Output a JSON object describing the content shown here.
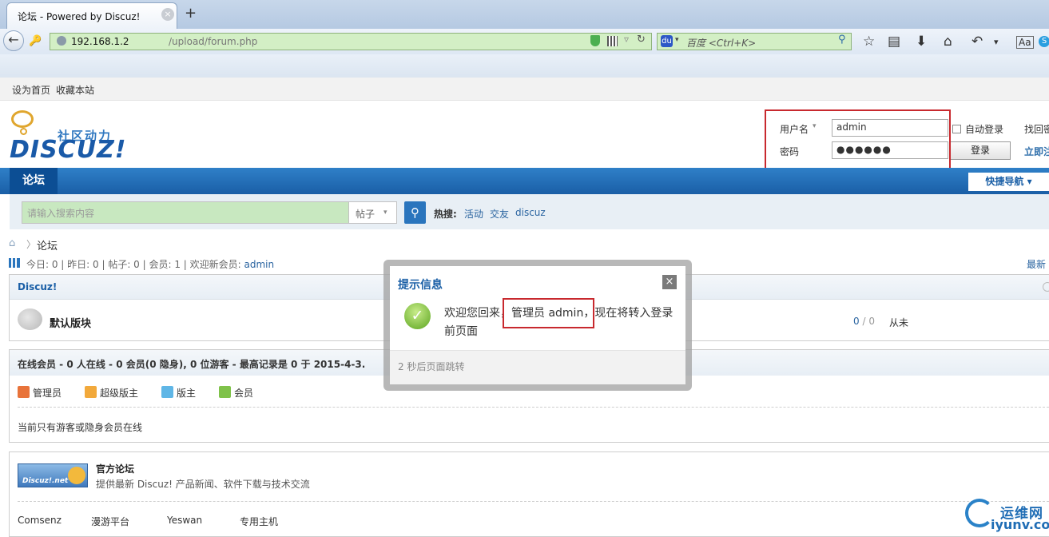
{
  "browser": {
    "tab_title": "论坛 - Powered by Discuz!",
    "tab_close": "×",
    "new_tab": "+",
    "url_host": "192.168.1.2",
    "url_path": "/upload/forum.php",
    "search_placeholder": "百度 <Ctrl+K>",
    "icons": [
      "back-icon",
      "identity-icon",
      "shield-icon",
      "qr-icon",
      "bookmark-star-icon",
      "reload-icon",
      "baidu-icon",
      "search-icon",
      "star-icon",
      "clipboard-icon",
      "download-icon",
      "home-icon",
      "undo-icon",
      "menu-icon",
      "translate-icon",
      "skype-icon"
    ]
  },
  "topbar": {
    "set_home": "设为首页",
    "bookmark": "收藏本站"
  },
  "logo": {
    "sub": "社区动力",
    "main": "DISCUZ!"
  },
  "login": {
    "username_label": "用户名",
    "password_label": "密码",
    "username_value": "admin",
    "password_value": "●●●●●●",
    "auto_login": "自动登录",
    "login_button": "登录",
    "find_password": "找回密",
    "register": "立即注"
  },
  "nav": {
    "forum_tab": "论坛",
    "quick_nav": "快捷导航 ▾"
  },
  "search": {
    "placeholder": "请输入搜索内容",
    "type": "帖子",
    "hot_label": "热搜:",
    "hot_links": [
      "活动",
      "交友",
      "discuz"
    ]
  },
  "breadcrumb": {
    "separator": "〉",
    "current": "论坛"
  },
  "stats": {
    "text": "今日: 0 | 昨日: 0 | 帖子: 0 | 会员: 1 | 欢迎新会员: ",
    "new_member": "admin",
    "latest": "最新"
  },
  "category": {
    "title": "Discuz!",
    "forum_name": "默认版块",
    "threads": "0",
    "posts": "0",
    "last_post": "从未"
  },
  "online": {
    "title": "在线会员 - 0 人在线 - 0 会员(0 隐身), 0 位游客 - 最高记录是 0 于 2015-4-3.",
    "legend": [
      {
        "label": "管理员",
        "color": "#e8733a"
      },
      {
        "label": "超级版主",
        "color": "#f2a93b"
      },
      {
        "label": "版主",
        "color": "#5fb6e6"
      },
      {
        "label": "会员",
        "color": "#7fc24a"
      }
    ],
    "empty_text": "当前只有游客或隐身会员在线"
  },
  "links": {
    "banner_text": "Discuz!.net",
    "official_title": "官方论坛",
    "official_desc": "提供最新 Discuz! 产品新闻、软件下载与技术交流",
    "friends": [
      "Comsenz",
      "漫游平台",
      "Yeswan",
      "专用主机"
    ]
  },
  "modal": {
    "title": "提示信息",
    "close": "×",
    "message_line1": "欢迎您回来，管理员 admin，现在将转入登录",
    "message_line2": "前页面",
    "countdown": "2 秒后页面跳转"
  },
  "watermark": {
    "cn": "运维网",
    "en": "iyunv.com"
  }
}
